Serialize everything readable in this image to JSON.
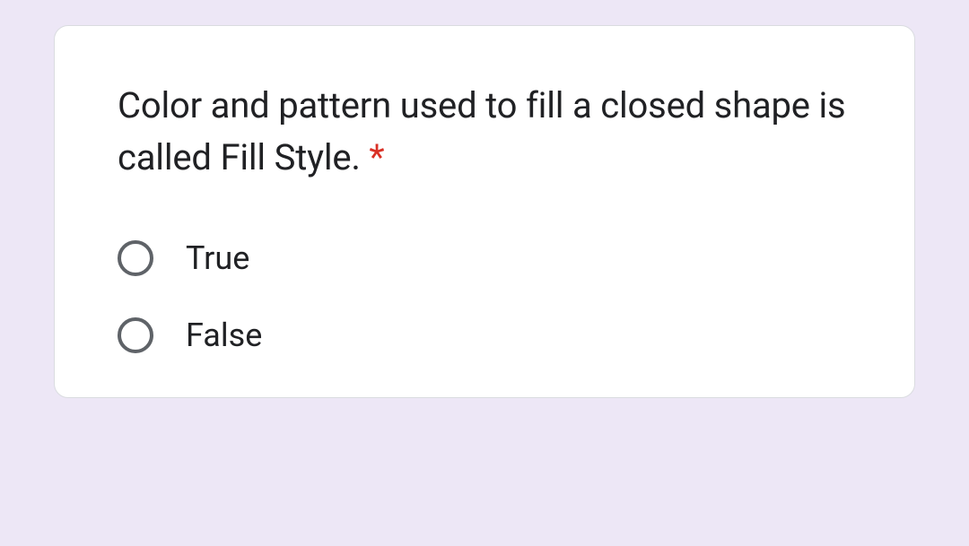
{
  "question": {
    "text": "Color and pattern used to fill a closed shape is called Fill Style. ",
    "required_marker": "*",
    "options": [
      {
        "label": "True"
      },
      {
        "label": "False"
      }
    ]
  }
}
